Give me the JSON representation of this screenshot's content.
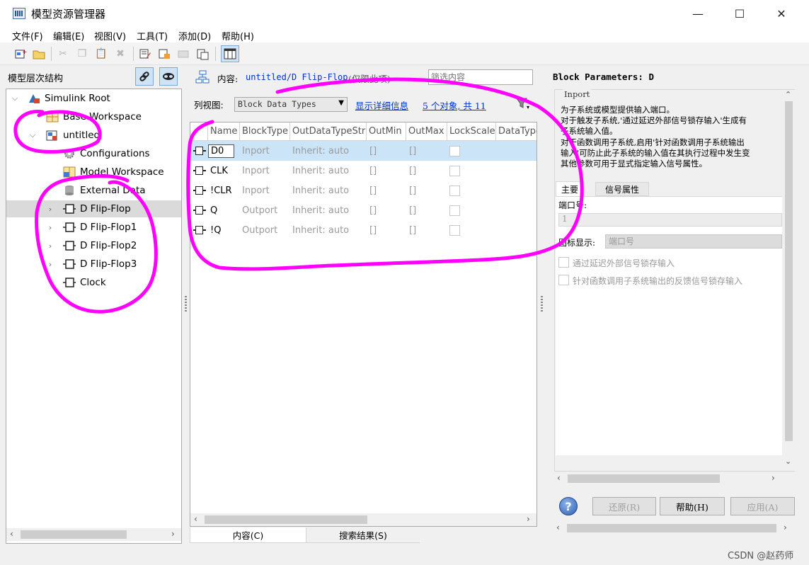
{
  "window": {
    "title": "模型资源管理器",
    "controls": [
      "—",
      "☐",
      "✕"
    ]
  },
  "menu": [
    "文件(F)",
    "编辑(E)",
    "视图(V)",
    "工具(T)",
    "添加(D)",
    "帮助(H)"
  ],
  "left_panel": {
    "title": "模型层次结构",
    "tree": [
      {
        "label": "Simulink Root",
        "icon": "simulink-root-icon",
        "expanded": true
      },
      {
        "label": "Base Workspace",
        "icon": "workspace-icon"
      },
      {
        "label": "untitled",
        "icon": "model-icon",
        "expanded": true
      },
      {
        "label": "Configurations",
        "icon": "gear-icon"
      },
      {
        "label": "Model Workspace",
        "icon": "workspace-icon"
      },
      {
        "label": "External Data",
        "icon": "database-icon"
      },
      {
        "label": "D Flip-Flop",
        "icon": "subsystem-icon",
        "selected": true
      },
      {
        "label": "D Flip-Flop1",
        "icon": "subsystem-icon"
      },
      {
        "label": "D Flip-Flop2",
        "icon": "subsystem-icon"
      },
      {
        "label": "D Flip-Flop3",
        "icon": "subsystem-icon"
      },
      {
        "label": "Clock",
        "icon": "subsystem-icon"
      }
    ]
  },
  "center_panel": {
    "content_label": "内容:",
    "content_path": "untitled/D Flip-Flop",
    "content_suffix": "(仅限此项)",
    "filter_placeholder": "筛选内容",
    "view_label": "列视图:",
    "view_value": "Block Data Types",
    "details_link": "显示详细信息",
    "count_text": "5 个对象, 共 11",
    "columns": [
      "Name",
      "BlockType",
      "OutDataTypeStr",
      "OutMin",
      "OutMax",
      "LockScale",
      "DataType"
    ],
    "rows": [
      {
        "name": "D0",
        "type": "Inport",
        "dtype": "Inherit: auto",
        "min": "[]",
        "max": "[]"
      },
      {
        "name": "CLK",
        "type": "Inport",
        "dtype": "Inherit: auto",
        "min": "[]",
        "max": "[]"
      },
      {
        "name": "!CLR",
        "type": "Inport",
        "dtype": "Inherit: auto",
        "min": "[]",
        "max": "[]"
      },
      {
        "name": "Q",
        "type": "Outport",
        "dtype": "Inherit: auto",
        "min": "[]",
        "max": "[]"
      },
      {
        "name": "!Q",
        "type": "Outport",
        "dtype": "Inherit: auto",
        "min": "[]",
        "max": "[]"
      }
    ],
    "tabs": [
      "内容(C)",
      "搜索结果(S)"
    ]
  },
  "right_panel": {
    "title": "Block Parameters: D",
    "group_title": "Inport",
    "description": [
      "为子系统或模型提供输入端口。",
      "对于触发子系统,'通过延迟外部信号锁存输入'生成有",
      "子系统输入值。",
      "对于函数调用子系统,启用'针对函数调用子系统输出",
      "输入'可防止此子系统的输入值在其执行过程中发生变",
      "其他参数可用于显式指定输入信号属性。"
    ],
    "tabs": [
      "主要",
      "信号属性"
    ],
    "port_label": "端口号:",
    "port_value": "1",
    "icon_label": "图标显示:",
    "icon_value": "端口号",
    "checkbox1": "通过延迟外部信号锁存输入",
    "checkbox2": "针对函数调用子系统输出的反馈信号锁存输入",
    "buttons": {
      "revert": "还原(R)",
      "help": "帮助(H)",
      "apply": "应用(A)"
    }
  },
  "watermark": "CSDN @赵药师",
  "colors": {
    "scribble": "#ff00ff",
    "selection": "#cce4f7",
    "link": "#0033cc"
  }
}
